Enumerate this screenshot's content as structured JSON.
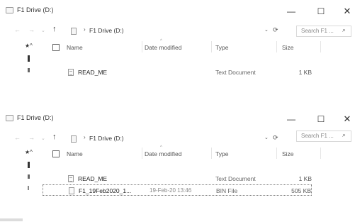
{
  "window1": {
    "title": "F1 Drive (D:)",
    "controls": {
      "minimize": "—",
      "maximize": "☐",
      "close": "✕"
    },
    "address": {
      "path": "F1 Drive (D:)",
      "separator": "›"
    },
    "search": {
      "placeholder": "Search F1 ..."
    },
    "columns": {
      "name": "Name",
      "date": "Date modified",
      "type": "Type",
      "size": "Size"
    },
    "files": [
      {
        "name": "READ_ME",
        "date": "",
        "type": "Text Document",
        "size": "1 KB"
      }
    ]
  },
  "window2": {
    "title": "F1 Drive (D:)",
    "controls": {
      "minimize": "—",
      "maximize": "☐",
      "close": "✕"
    },
    "address": {
      "path": "F1 Drive (D:)",
      "separator": "›"
    },
    "search": {
      "placeholder": "Search F1 ..."
    },
    "columns": {
      "name": "Name",
      "date": "Date modified",
      "type": "Type",
      "size": "Size"
    },
    "files": [
      {
        "name": "READ_ME",
        "date": "",
        "type": "Text Document",
        "size": "1 KB"
      },
      {
        "name": "F1_19Feb2020_1...",
        "date": "19-Feb-20 13:46",
        "type": "BIN File",
        "size": "505 KB"
      }
    ]
  },
  "icons": {
    "back": "arrow-left-icon",
    "forward": "arrow-right-icon",
    "up": "arrow-up-icon",
    "refresh": "refresh-icon",
    "search": "search-icon",
    "drive": "drive-icon",
    "file": "file-icon"
  }
}
